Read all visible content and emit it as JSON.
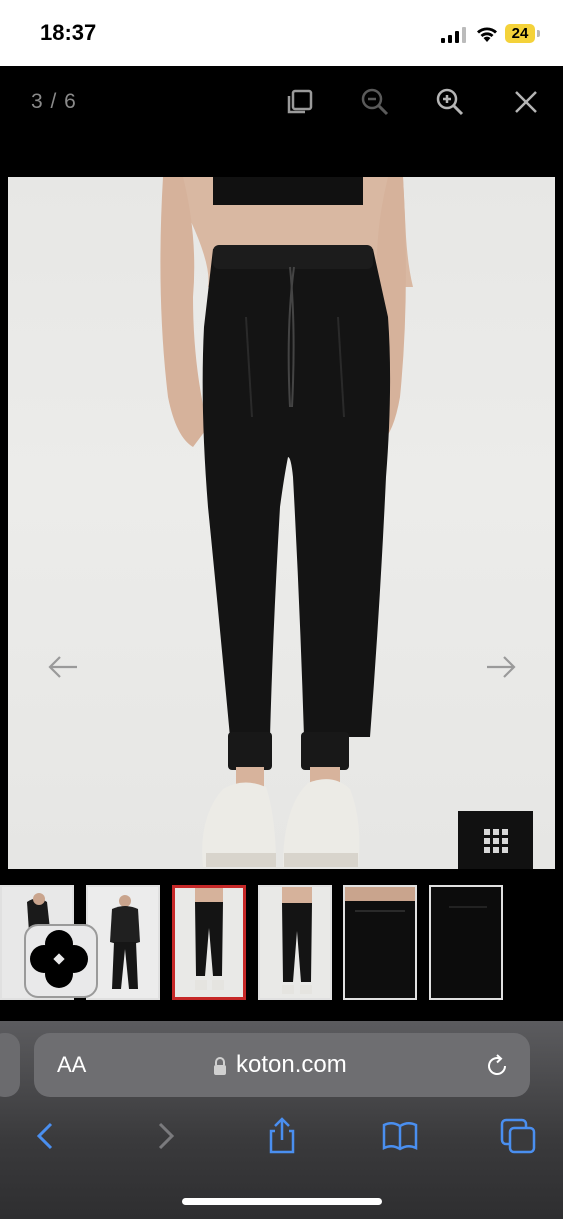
{
  "status_bar": {
    "time": "18:37",
    "battery": "24",
    "icons": [
      "cellular-signal-icon",
      "wifi-icon",
      "battery-icon"
    ],
    "battery_color": "#f4d23a"
  },
  "viewer": {
    "counter": "3 / 6",
    "toolbar": [
      "fullscreen-icon",
      "zoom-out-icon",
      "zoom-in-icon",
      "close-icon"
    ],
    "image": {
      "subject": "black jogger pants",
      "nav": [
        "arrow-left-icon",
        "arrow-right-icon"
      ]
    },
    "grid_toggle_icon": "grid-icon",
    "thumbnails": {
      "count": 6,
      "active_index": 2,
      "active_border_color": "#c62828"
    }
  },
  "safari": {
    "aa": "AA",
    "url": "koton.com",
    "icons": [
      "lock-icon",
      "reload-icon",
      "back-icon",
      "forward-icon",
      "share-icon",
      "bookmarks-icon",
      "tabs-icon"
    ],
    "accent_color": "#4a8ff0"
  }
}
